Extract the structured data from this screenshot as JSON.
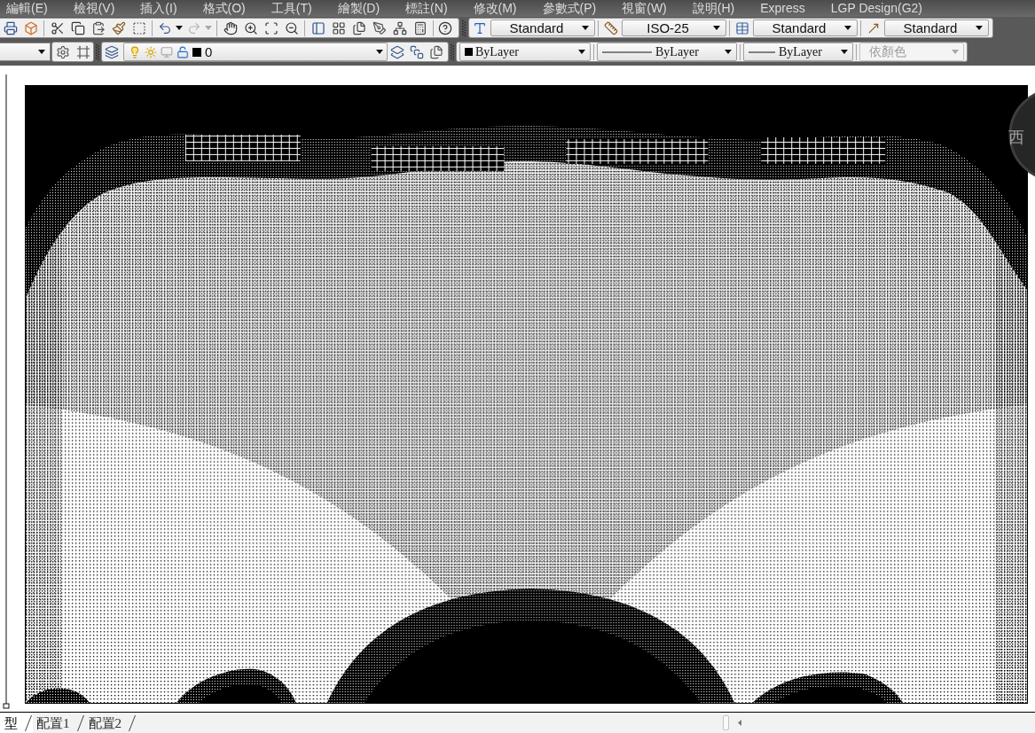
{
  "menu_bar": {
    "items": [
      "編輯(E)",
      "檢視(V)",
      "插入(I)",
      "格式(O)",
      "工具(T)",
      "繪製(D)",
      "標註(N)",
      "修改(M)",
      "參數式(P)",
      "視窗(W)",
      "說明(H)",
      "Express",
      "LGP Design(G2)"
    ]
  },
  "standard_toolbar": {
    "history": [
      {
        "kind": "undo",
        "disabled": false
      },
      {
        "kind": "redo",
        "disabled": true
      }
    ]
  },
  "styles_toolbar": {
    "dropdowns": [
      {
        "kind": "text",
        "value": "Standard"
      },
      {
        "kind": "dimension",
        "value": "ISO-25"
      },
      {
        "kind": "table",
        "value": "Standard"
      },
      {
        "kind": "multileader",
        "value": "Standard"
      }
    ]
  },
  "layers_toolbar": {
    "layer": {
      "value": "0",
      "on": true,
      "frozen": false,
      "locked": false
    }
  },
  "properties_toolbar": {
    "dropdowns": [
      {
        "kind": "color",
        "value": "ByLayer",
        "disabled": false
      },
      {
        "kind": "linetype",
        "value": "ByLayer",
        "disabled": false
      },
      {
        "kind": "lineweight",
        "value": "ByLayer",
        "disabled": false
      },
      {
        "kind": "plotstyle",
        "value": "依顏色",
        "disabled": true
      }
    ]
  },
  "viewcube": {
    "label": "西"
  },
  "layout_tabs": [
    {
      "label": "型",
      "selected": true
    },
    {
      "label": "配置1",
      "selected": false
    },
    {
      "label": "配置2",
      "selected": false
    }
  ]
}
